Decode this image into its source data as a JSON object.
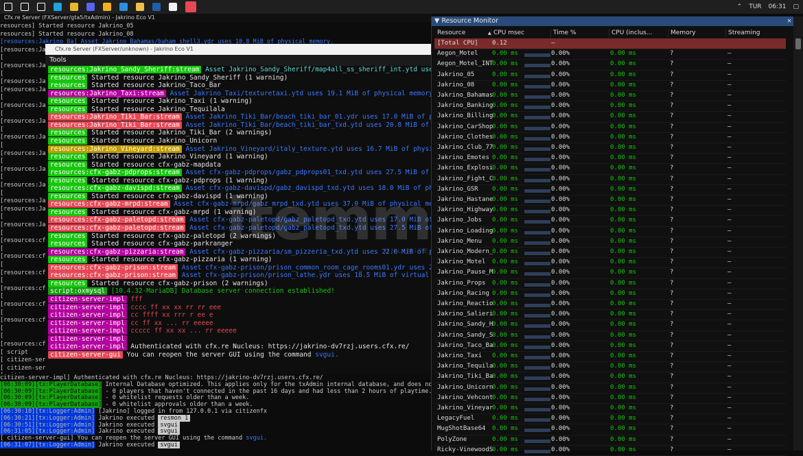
{
  "taskbar": {
    "icons": [
      "windows-icon",
      "search-icon",
      "taskview-icon",
      "edge-icon",
      "chrome-icon",
      "discord-icon",
      "yellow-icon",
      "vscode-icon",
      "explorer-icon",
      "steam-icon",
      "github-icon",
      "txadmin-icon"
    ],
    "lang": "TUR",
    "time": "06:31"
  },
  "console": {
    "title": "Cfx.re Server (FXServer/gta5/txAdmin) - Jakrino Eco V1",
    "lines": [
      "         resources] Started resource Jakrino_05",
      "         resources] Started resource Jakrino_08",
      "[resources:Jakrino_Ba] Asset Jakrino_Bahamas/baham_shell3.ydr uses 10.8 MiB of physical memory.",
      "[resources:Ja",
      "[",
      "[resources:Ja",
      "[",
      "[resources:Ja",
      "[resources:Ja",
      "[",
      "[resources:Ja",
      "[",
      "[resources:Ja",
      "[",
      "[resources:Ja",
      "[",
      "[resources:Ja",
      "[",
      "[resources:Ja",
      "[",
      "[resources:Ja",
      "[",
      "[resources:Ja",
      "[resources:Ja",
      "[",
      "[resources:Ja",
      "[",
      "[resources:cfx",
      "[",
      "[resources:cfx",
      "[",
      "[resources:cfx",
      "[",
      "[resources:cfx",
      "[",
      "[resources:cfx",
      "[",
      "[resources:cfx",
      "[",
      "[",
      "[resources:cfx",
      "[      script",
      "[ citizen-serv",
      "[ citizen-serv",
      "[ citizen-serv",
      "[ citizen-serv",
      "[ citizen-serv"
    ]
  },
  "inner_window": {
    "title": "Cfx.re Server (FXServer/unknown) - Jakrino Eco V1",
    "menu": "Tools",
    "lines": [
      {
        "tag": "resources:Jakrino_Sandy_Sheriff:stream",
        "tone": "green",
        "text": " Asset Jakrino_Sandy_Sheriff/map4all_ss_sheriff_int.ytd uses 1",
        "style": "asset2"
      },
      {
        "tag": "resources",
        "tone": "green",
        "text": " Started resource Jakrino_Sandy_Sheriff (1 warning)",
        "style": ""
      },
      {
        "tag": "resources",
        "tone": "green",
        "text": " Started resource Jakrino_Taco_Bar",
        "style": ""
      },
      {
        "tag": "resources:Jakrino_Taxi:stream",
        "tone": "pink",
        "text": " Asset Jakrino_Taxi/texturetaxi.ytd uses 19.1 MiB of physical memory.",
        "style": "asset"
      },
      {
        "tag": "resources",
        "tone": "green",
        "text": " Started resource Jakrino_Taxi (1 warning)",
        "style": ""
      },
      {
        "tag": "resources",
        "tone": "green",
        "text": " Started resource Jakrino_Tequilala",
        "style": ""
      },
      {
        "tag": "resources:Jakrino_Tiki_Bar:stream",
        "tone": "red",
        "text": " Asset Jakrino_Tiki_Bar/beach_tiki_bar_01.ydr uses 17.0 MiB of physi",
        "style": "asset"
      },
      {
        "tag": "resources:Jakrino_Tiki_Bar:stream",
        "tone": "red",
        "text": " Asset Jakrino_Tiki_Bar/beach_tiki_bar_txd.ytd uses 20.8 MiB of phys",
        "style": "asset"
      },
      {
        "tag": "resources",
        "tone": "green",
        "text": " Started resource Jakrino_Tiki_Bar (2 warnings)",
        "style": ""
      },
      {
        "tag": "resources",
        "tone": "green",
        "text": " Started resource Jakrino_Unicorn",
        "style": ""
      },
      {
        "tag": "resources:Jakrino_Vineyard:stream",
        "tone": "yellow",
        "text": " Asset Jakrino_Vineyard/italy_texture.ytd uses 16.7 MiB of physical",
        "style": "asset"
      },
      {
        "tag": "resources",
        "tone": "green",
        "text": " Started resource Jakrino_Vineyard (1 warning)",
        "style": ""
      },
      {
        "tag": "resources",
        "tone": "green",
        "text": " Started resource cfx-gabz-mapdata",
        "style": ""
      },
      {
        "tag": "resources:cfx-gabz-pdprops:stream",
        "tone": "green",
        "text": " Asset cfx-gabz-pdprops/gabz_pdprops01_txd.ytd uses 27.5 MiB of phy",
        "style": "asset"
      },
      {
        "tag": "resources",
        "tone": "green",
        "text": " Started resource cfx-gabz-pdprops (1 warning)",
        "style": ""
      },
      {
        "tag": "resources:cfx-gabz-davispd:stream",
        "tone": "green",
        "text": " Asset cfx-gabz-davispd/gabz_davispd_txd.ytd uses 18.0 MiB of physi",
        "style": "asset"
      },
      {
        "tag": "resources",
        "tone": "green",
        "text": " Started resource cfx-gabz-davispd (1 warning)",
        "style": ""
      },
      {
        "tag": "resources:cfx-gabz-mrpd:stream",
        "tone": "red",
        "text": " Asset cfx-gabz-mrpd/gabz_mrpd_txd.ytd uses 37.0 MiB of physical memory",
        "style": "asset"
      },
      {
        "tag": "resources",
        "tone": "green",
        "text": " Started resource cfx-gabz-mrpd (1 warning)",
        "style": ""
      },
      {
        "tag": "resources:cfx-gabz-paletopd:stream",
        "tone": "red",
        "text": " Asset cfx-gabz-paletopd/gabz_paletopd_txd.ytd uses 17.0 MiB of phy",
        "style": "asset"
      },
      {
        "tag": "resources:cfx-gabz-paletopd:stream",
        "tone": "red",
        "text": " Asset cfx-gabz-paletopd/gabz_paletopd_txd.ytd uses 27.5 MiB of phy",
        "style": "asset"
      },
      {
        "tag": "resources",
        "tone": "green",
        "text": " Started resource cfx-gabz-paletopd (2 warnings)",
        "style": ""
      },
      {
        "tag": "resources",
        "tone": "green",
        "text": " Started resource cfx-gabz-parkranger",
        "style": ""
      },
      {
        "tag": "resources:cfx-gabz-pizzaria:stream",
        "tone": "pink",
        "text": " Asset cfx-gabz-pizzaria/sm_pizzeria_txd.ytd uses 22.0 MiB of phys",
        "style": "asset"
      },
      {
        "tag": "resources",
        "tone": "green",
        "text": " Started resource cfx-gabz-pizzaria (1 warning)",
        "style": ""
      },
      {
        "tag": "resources:cfx-gabz-prison:stream",
        "tone": "red",
        "text": " Asset cfx-gabz-prison/prison_common_room_cage_rooms01.ydr uses 24.0",
        "style": "asset"
      },
      {
        "tag": "resources:cfx-gabz-prison:stream",
        "tone": "red",
        "text": " Asset cfx-gabz-prison/prison_lathe.ydr uses 18.5 MiB of virtual memo",
        "style": "asset"
      },
      {
        "tag": "resources",
        "tone": "green",
        "text": " Started resource cfx-gabz-prison (2 warnings)",
        "style": ""
      },
      {
        "tag": "script:oxmysql",
        "tone": "grn2",
        "text": " [10.4.32-MariaDB] Database server connection established!",
        "style": "ok"
      },
      {
        "tag": "citizen-server-impl",
        "tone": "pink",
        "text": "        fff",
        "style": "red"
      },
      {
        "tag": "citizen-server-impl",
        "tone": "pink",
        "text": "  cccc ff   xx  xx     rr rr    eee",
        "style": "red"
      },
      {
        "tag": "citizen-server-impl",
        "tone": "pink",
        "text": " cc    ffff   xx       rrr  r ee  e",
        "style": "red"
      },
      {
        "tag": "citizen-server-impl",
        "tone": "pink",
        "text": " cc     ff     xx   ... rr     eeeee",
        "style": "red"
      },
      {
        "tag": "citizen-server-impl",
        "tone": "pink",
        "text": "  ccccc ff   xx  xx ... rr      eeeee",
        "style": "red"
      },
      {
        "tag": "citizen-server-impl",
        "tone": "pink",
        "text": "",
        "style": ""
      },
      {
        "tag": "citizen-server-impl",
        "tone": "pink",
        "text": " Authenticated with cfx.re Nucleus: https://jakrino-dv7rzj.users.cfx.re/",
        "style": ""
      },
      {
        "tag": "citizen-server-gui",
        "tone": "red",
        "text": " You can reopen the server GUI using the command ",
        "style": "",
        "cmd": "svgui."
      }
    ]
  },
  "bottom_log": {
    "lines": [
      {
        "ts": "",
        "tag": " citizen-server-impl] Authenticated with cfx.re Nucleus: https://jakrino-dv7rzj.users.cfx.re/",
        "kind": "plain",
        "text": ""
      },
      {
        "ts": "[06:30:09]",
        "tag": "[tx:PlayerDatabase]",
        "kind": "g",
        "text": " Internal Database optimized. This applies only for the txAdmin internal database, and does not affe"
      },
      {
        "ts": "[06:30:09]",
        "tag": "[tx:PlayerDatabase]",
        "kind": "g",
        "text": " - 0 players that haven't connected in the past 16 days and had less than 2 hours of playtime."
      },
      {
        "ts": "[06:30:09]",
        "tag": "[tx:PlayerDatabase]",
        "kind": "g",
        "text": " - 0 whitelist requests older than a week."
      },
      {
        "ts": "[06:30:09]",
        "tag": "[tx:PlayerDatabase]",
        "kind": "g",
        "text": " - 0 whitelist approvals older than a week."
      },
      {
        "ts": "[06:30:10]",
        "tag": "[tx:Logger:Admin]",
        "kind": "b",
        "text": " [Jakrino] logged in from 127.0.0.1 via citizenfx"
      },
      {
        "ts": "[06:30:21]",
        "tag": "[tx:Logger:Admin]",
        "kind": "b",
        "text": " Jakrino executed ",
        "cmd": "resmon 1"
      },
      {
        "ts": "[06:30:51]",
        "tag": "[tx:Logger:Admin]",
        "kind": "b",
        "text": " Jakrino executed ",
        "cmd": "svgui"
      },
      {
        "ts": "[06:31:05]",
        "tag": "[tx:Logger:Admin]",
        "kind": "b",
        "text": " Jakrino executed ",
        "cmd": "svgui"
      },
      {
        "ts": "",
        "tag": "[  citizen-server-gui]",
        "kind": "plain",
        "text": " You can reopen the server GUI using the command ",
        "link": "svgui."
      },
      {
        "ts": "[06:31:07]",
        "tag": "[tx:Logger:Admin]",
        "kind": "b",
        "text": " Jakrino executed ",
        "cmd": "svgui"
      }
    ]
  },
  "resmon": {
    "title": "Resource Monitor",
    "close": "✕",
    "columns": [
      "Resource",
      "CPU msec",
      "Time %",
      "CPU (inclus...",
      "Memory",
      "Streaming"
    ],
    "rows": [
      {
        "name": "[Total CPU]",
        "cpu": "0.12",
        "time": "–",
        "incl": "",
        "mem": "",
        "str": "",
        "total": true
      },
      {
        "name": "Aegon_Motel",
        "cpu": "0.00 ms",
        "time": "0.00%",
        "incl": "0.00 ms",
        "mem": "?",
        "str": "–"
      },
      {
        "name": "Aegon_Motel_INT",
        "cpu": "0.00 ms",
        "time": "0.00%",
        "incl": "0.00 ms",
        "mem": "?",
        "str": "–"
      },
      {
        "name": "Jakrino_05",
        "cpu": "0.00 ms",
        "time": "0.00%",
        "incl": "0.00 ms",
        "mem": "?",
        "str": "–"
      },
      {
        "name": "Jakrino_08",
        "cpu": "0.00 ms",
        "time": "0.00%",
        "incl": "0.00 ms",
        "mem": "?",
        "str": "–"
      },
      {
        "name": "Jakrino_Bahamas",
        "cpu": "0.00 ms",
        "time": "0.00%",
        "incl": "0.00 ms",
        "mem": "?",
        "str": "–"
      },
      {
        "name": "Jakrino_Banking",
        "cpu": "0.00 ms",
        "time": "0.00%",
        "incl": "0.00 ms",
        "mem": "?",
        "str": "–"
      },
      {
        "name": "Jakrino_Billing",
        "cpu": "0.00 ms",
        "time": "0.00%",
        "incl": "0.00 ms",
        "mem": "?",
        "str": "–"
      },
      {
        "name": "Jakrino_CarShop",
        "cpu": "0.00 ms",
        "time": "0.00%",
        "incl": "0.00 ms",
        "mem": "?",
        "str": "–"
      },
      {
        "name": "Jakrino_Clothes",
        "cpu": "0.00 ms",
        "time": "0.00%",
        "incl": "0.00 ms",
        "mem": "?",
        "str": "–"
      },
      {
        "name": "Jakrino_Club_77",
        "cpu": "0.00 ms",
        "time": "0.00%",
        "incl": "0.00 ms",
        "mem": "?",
        "str": "–"
      },
      {
        "name": "Jakrino_Emotes",
        "cpu": "0.00 ms",
        "time": "0.00%",
        "incl": "0.00 ms",
        "mem": "?",
        "str": "–"
      },
      {
        "name": "Jakrino_Explosi",
        "cpu": "0.00 ms",
        "time": "0.00%",
        "incl": "0.00 ms",
        "mem": "?",
        "str": "–"
      },
      {
        "name": "Jakrino_Fight_C",
        "cpu": "0.00 ms",
        "time": "0.00%",
        "incl": "0.00 ms",
        "mem": "?",
        "str": "–"
      },
      {
        "name": "Jakrino_GSR",
        "cpu": "0.00 ms",
        "time": "0.00%",
        "incl": "0.00 ms",
        "mem": "?",
        "str": "–"
      },
      {
        "name": "Jakrino_Hastane",
        "cpu": "0.00 ms",
        "time": "0.00%",
        "incl": "0.00 ms",
        "mem": "?",
        "str": "–"
      },
      {
        "name": "Jakrino_Highway",
        "cpu": "0.00 ms",
        "time": "0.00%",
        "incl": "0.00 ms",
        "mem": "?",
        "str": "–"
      },
      {
        "name": "Jakrino_Jobs",
        "cpu": "0.00 ms",
        "time": "0.00%",
        "incl": "0.00 ms",
        "mem": "?",
        "str": "–"
      },
      {
        "name": "Jakrino_Loading",
        "cpu": "0.00 ms",
        "time": "0.00%",
        "incl": "0.00 ms",
        "mem": "?",
        "str": "–"
      },
      {
        "name": "Jakrino_Menu",
        "cpu": "0.00 ms",
        "time": "0.00%",
        "incl": "0.00 ms",
        "mem": "?",
        "str": "–"
      },
      {
        "name": "Jakrino_Modern_",
        "cpu": "0.00 ms",
        "time": "0.00%",
        "incl": "0.00 ms",
        "mem": "?",
        "str": "–"
      },
      {
        "name": "Jakrino_Motel",
        "cpu": "0.00 ms",
        "time": "0.00%",
        "incl": "0.00 ms",
        "mem": "?",
        "str": "–"
      },
      {
        "name": "Jakrino_Pause_M",
        "cpu": "0.00 ms",
        "time": "0.00%",
        "incl": "0.00 ms",
        "mem": "?",
        "str": "–"
      },
      {
        "name": "Jakrino_Props",
        "cpu": "0.00 ms",
        "time": "0.00%",
        "incl": "0.00 ms",
        "mem": "?",
        "str": "–"
      },
      {
        "name": "Jakrino_Racing",
        "cpu": "0.00 ms",
        "time": "0.00%",
        "incl": "0.00 ms",
        "mem": "?",
        "str": "–"
      },
      {
        "name": "Jakrino_Reactio",
        "cpu": "0.00 ms",
        "time": "0.00%",
        "incl": "0.00 ms",
        "mem": "?",
        "str": "–"
      },
      {
        "name": "Jakrino_Salieri",
        "cpu": "0.00 ms",
        "time": "0.00%",
        "incl": "0.00 ms",
        "mem": "?",
        "str": "–"
      },
      {
        "name": "Jakrino_Sandy_H",
        "cpu": "0.00 ms",
        "time": "0.00%",
        "incl": "0.00 ms",
        "mem": "?",
        "str": "–"
      },
      {
        "name": "Jakrino_Sandy_S",
        "cpu": "0.00 ms",
        "time": "0.00%",
        "incl": "0.00 ms",
        "mem": "?",
        "str": "–"
      },
      {
        "name": "Jakrino_Taco_Ba",
        "cpu": "0.00 ms",
        "time": "0.00%",
        "incl": "0.00 ms",
        "mem": "?",
        "str": "–"
      },
      {
        "name": "Jakrino_Taxi",
        "cpu": "0.00 ms",
        "time": "0.00%",
        "incl": "0.00 ms",
        "mem": "?",
        "str": "–"
      },
      {
        "name": "Jakrino_Tequila",
        "cpu": "0.00 ms",
        "time": "0.00%",
        "incl": "0.00 ms",
        "mem": "?",
        "str": "–"
      },
      {
        "name": "Jakrino_Tiki_Ba",
        "cpu": "0.00 ms",
        "time": "0.00%",
        "incl": "0.00 ms",
        "mem": "?",
        "str": "–"
      },
      {
        "name": "Jakrino_Unicorn",
        "cpu": "0.00 ms",
        "time": "0.00%",
        "incl": "0.00 ms",
        "mem": "?",
        "str": "–"
      },
      {
        "name": "Jakrino_Vehcont",
        "cpu": "0.00 ms",
        "time": "0.00%",
        "incl": "0.00 ms",
        "mem": "?",
        "str": "–"
      },
      {
        "name": "Jakrino_Vineyar",
        "cpu": "0.00 ms",
        "time": "0.00%",
        "incl": "0.00 ms",
        "mem": "?",
        "str": "–"
      },
      {
        "name": "LegacyFuel",
        "cpu": "0.00 ms",
        "time": "0.00%",
        "incl": "0.00 ms",
        "mem": "?",
        "str": "–"
      },
      {
        "name": "MugShotBase64",
        "cpu": "0.00 ms",
        "time": "0.00%",
        "incl": "0.00 ms",
        "mem": "?",
        "str": "–"
      },
      {
        "name": "PolyZone",
        "cpu": "0.00 ms",
        "time": "0.00%",
        "incl": "0.00 ms",
        "mem": "?",
        "str": "–"
      },
      {
        "name": "Ricky-VinewoodS",
        "cpu": "0.00 ms",
        "time": "0.00%",
        "incl": "0.00 ms",
        "mem": "?",
        "str": "–"
      }
    ]
  },
  "watermark": {
    "text": "itemmatis",
    "sub": "UNLIMITED GAMING"
  },
  "colors": {
    "accent": "#294a7a",
    "green": "#16c60c",
    "red": "#e74856",
    "pink": "#b4009e",
    "yellow": "#c19c00"
  }
}
